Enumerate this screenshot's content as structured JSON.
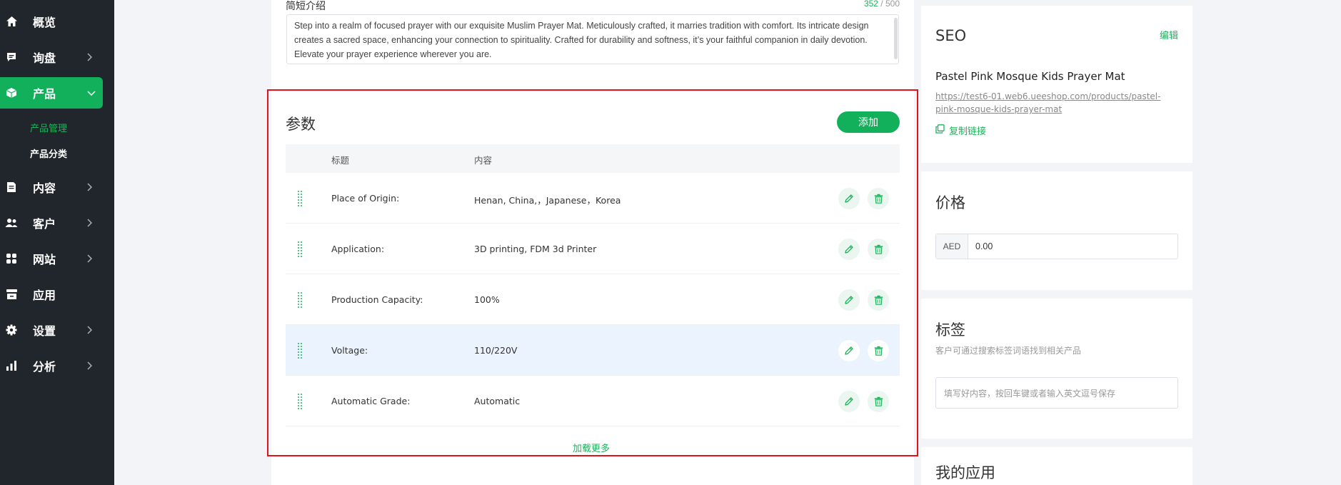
{
  "sidebar": {
    "items": [
      {
        "label": "概览",
        "icon": "home-icon"
      },
      {
        "label": "询盘",
        "icon": "message-icon"
      },
      {
        "label": "产品",
        "icon": "box-icon"
      },
      {
        "label": "内容",
        "icon": "document-icon"
      },
      {
        "label": "客户",
        "icon": "users-icon"
      },
      {
        "label": "网站",
        "icon": "grid-icon"
      },
      {
        "label": "应用",
        "icon": "store-icon"
      },
      {
        "label": "设置",
        "icon": "gear-icon"
      },
      {
        "label": "分析",
        "icon": "bar-chart-icon"
      }
    ],
    "subitems": [
      {
        "label": "产品管理"
      },
      {
        "label": "产品分类"
      }
    ]
  },
  "short_desc": {
    "label": "简短介绍",
    "count": "352",
    "max": " / 500",
    "text": "Step into a realm of focused prayer with our exquisite Muslim Prayer Mat. Meticulously crafted, it marries tradition with comfort. Its intricate design creates a sacred space, enhancing your connection to spirituality. Crafted for durability and softness, it’s your faithful companion in daily devotion. Elevate your prayer experience wherever you are."
  },
  "params": {
    "title": "参数",
    "add_label": "添加",
    "col_title": "标题",
    "col_content": "内容",
    "rows": [
      {
        "title": "Place of Origin:",
        "content": "Henan, China,，Japanese，Korea"
      },
      {
        "title": "Application:",
        "content": "3D printing, FDM 3d Printer"
      },
      {
        "title": "Production Capacity:",
        "content": "100%"
      },
      {
        "title": "Voltage:",
        "content": "110/220V"
      },
      {
        "title": "Automatic Grade:",
        "content": "Automatic"
      }
    ],
    "load_more": "加载更多"
  },
  "seo": {
    "title": "SEO",
    "edit": "编辑",
    "name": "Pastel Pink Mosque Kids Prayer Mat",
    "url": "https://test6-01.web6.ueeshop.com/products/pastel-pink-mosque-kids-prayer-mat",
    "copy": "复制链接"
  },
  "price": {
    "title": "价格",
    "currency": "AED",
    "value": "0.00"
  },
  "tags": {
    "title": "标签",
    "subtitle": "客户可通过搜索标签词语找到相关产品",
    "placeholder": "填写好内容，按回车键或者输入英文逗号保存"
  },
  "apps": {
    "title": "我的应用"
  },
  "colors": {
    "accent": "#12b05a",
    "sidebar": "#21262c",
    "highlight": "#e2141b"
  }
}
